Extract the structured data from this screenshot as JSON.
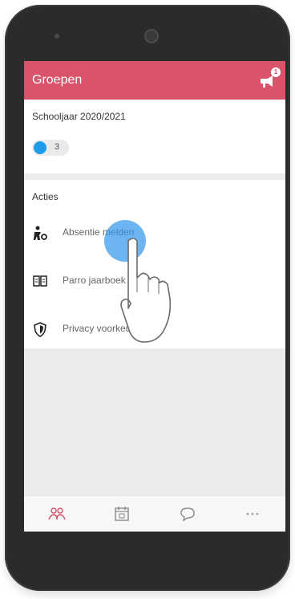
{
  "app": {
    "title": "Groepen",
    "notification_count": "1"
  },
  "school_year": {
    "label": "Schooljaar 2020/2021",
    "toggle_count": "3"
  },
  "actions": {
    "title": "Acties",
    "items": [
      {
        "label": "Absentie melden",
        "icon": "person-absence-icon"
      },
      {
        "label": "Parro jaarboek",
        "icon": "book-icon"
      },
      {
        "label": "Privacy voorkeuren",
        "icon": "shield-icon"
      }
    ]
  },
  "tabs": [
    {
      "name": "groups",
      "icon": "group-icon",
      "active": true
    },
    {
      "name": "calendar",
      "icon": "calendar-icon",
      "active": false
    },
    {
      "name": "chat",
      "icon": "chat-bubble-icon",
      "active": false
    },
    {
      "name": "more",
      "icon": "more-icon",
      "active": false
    }
  ],
  "colors": {
    "accent": "#d9536a",
    "toggle_on": "#1e9be8",
    "touch": "#2f96eb"
  }
}
